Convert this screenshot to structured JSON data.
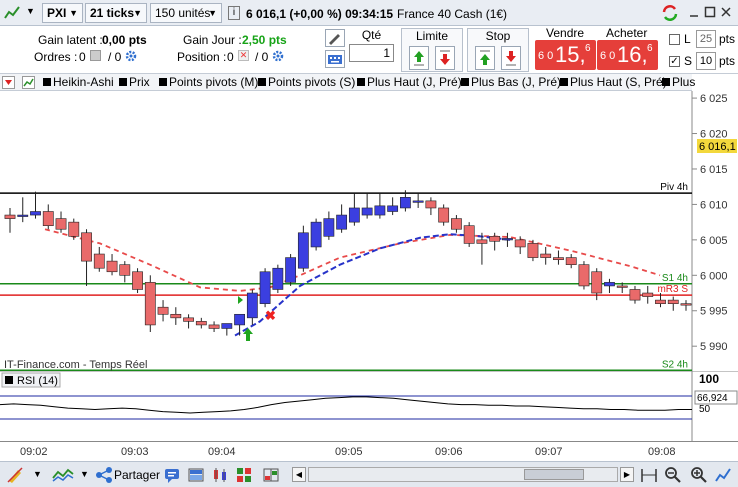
{
  "topbar": {
    "symbol": "PXI",
    "period": "21 ticks",
    "quantity": "150 unités",
    "price_line": "6 016,1 (+0,00 %) 09:34:15",
    "instrument": "France 40 Cash (1€)"
  },
  "orders": {
    "gain_latent_label": "Gain latent :",
    "gain_latent_value": "0,00 pts",
    "ordres_label": "Ordres :",
    "ordres_a": "0",
    "ordres_b": "/ 0",
    "gain_jour_label": "Gain Jour :",
    "gain_jour_value": "2,50 pts",
    "position_label": "Position :",
    "position_a": "0",
    "position_b": "/ 0",
    "qty_label": "Qté",
    "qty_value": "1",
    "limit_label": "Limite",
    "stop_label": "Stop",
    "sell_label": "Vendre",
    "sell_prefix": "6 0",
    "sell_big": "15,",
    "sell_sup": "6",
    "buy_label": "Acheter",
    "buy_prefix": "6 0",
    "buy_big": "16,",
    "buy_sup": "6",
    "l_label": "L",
    "l_value": "25",
    "l_unit": "pts",
    "s_label": "S",
    "s_value": "10",
    "s_unit": "pts"
  },
  "indicators": [
    {
      "label": "Heikin-Ashi",
      "color": "#000000"
    },
    {
      "label": "Prix",
      "color": "#000000"
    },
    {
      "label": "Points pivots (M)",
      "color": "#000000"
    },
    {
      "label": "Points pivots (S)",
      "color": "#000000"
    },
    {
      "label": "Plus Haut (J, Pré)",
      "color": "#000000"
    },
    {
      "label": "Plus Bas (J, Pré)",
      "color": "#000000"
    },
    {
      "label": "Plus Haut (S, Pré)",
      "color": "#000000"
    },
    {
      "label": "Plus",
      "color": "#000000"
    }
  ],
  "chart_data": {
    "type": "candlestick",
    "ylim": [
      5986.5,
      6026
    ],
    "yticks": [
      "6 025",
      "6 020",
      "6 015",
      "6 010",
      "6 005",
      "6 000",
      "5 995",
      "5 990"
    ],
    "last_price_label": "6 016,1",
    "source_label": "IT-Finance.com - Temps Réel",
    "lines": [
      {
        "label": "Piv 4h",
        "value": 6011.6,
        "color": "#000000"
      },
      {
        "label": "S1 4h",
        "value": 5998.8,
        "color": "#1a8a1a"
      },
      {
        "label": "mR3 S",
        "value": 5997.2,
        "color": "#e02020"
      },
      {
        "label": "S2 4h",
        "value": 5986.6,
        "color": "#1a8a1a"
      }
    ],
    "candles": [
      [
        6008.5,
        6009.5,
        6006,
        6008
      ],
      [
        6008.5,
        6011,
        6007.5,
        6008.5
      ],
      [
        6008.5,
        6011.8,
        6008,
        6009
      ],
      [
        6009,
        6010,
        6006.5,
        6007
      ],
      [
        6008,
        6009,
        6006,
        6006.5
      ],
      [
        6007.5,
        6008,
        6005,
        6005.5
      ],
      [
        6006,
        6006.5,
        5998.5,
        6002
      ],
      [
        6003,
        6004,
        6000.5,
        6001
      ],
      [
        6002,
        6003,
        6000,
        6000.5
      ],
      [
        6001.5,
        6002,
        5999,
        6000
      ],
      [
        6000.5,
        6001,
        5997.5,
        5998
      ],
      [
        5999,
        6000,
        5992,
        5993
      ],
      [
        5995.5,
        5996.5,
        5993.5,
        5994.5
      ],
      [
        5994.5,
        5995.5,
        5993,
        5994
      ],
      [
        5994,
        5994.5,
        5992.5,
        5993.5
      ],
      [
        5993.5,
        5994,
        5992.5,
        5993
      ],
      [
        5993,
        5993.5,
        5992,
        5992.5
      ],
      [
        5992.5,
        5993,
        5991.5,
        5993.2
      ],
      [
        5993,
        5994,
        5991.5,
        5994.5
      ],
      [
        5994,
        5998,
        5993,
        5997.5
      ],
      [
        5996,
        6001,
        5995.5,
        6000.5
      ],
      [
        5998,
        6001.5,
        5997.5,
        6001
      ],
      [
        5999,
        6003,
        5998.5,
        6002.5
      ],
      [
        6001,
        6007,
        6000.5,
        6006
      ],
      [
        6004,
        6008,
        6003.5,
        6007.5
      ],
      [
        6005.5,
        6009,
        6005,
        6008
      ],
      [
        6006.5,
        6010,
        6006,
        6008.5
      ],
      [
        6007.5,
        6011.5,
        6007,
        6009.5
      ],
      [
        6008.5,
        6011.5,
        6008,
        6009.5
      ],
      [
        6008.5,
        6011.5,
        6008,
        6009.8
      ],
      [
        6009,
        6011,
        6008.5,
        6009.8
      ],
      [
        6009.5,
        6012,
        6009,
        6011
      ],
      [
        6010.5,
        6011.5,
        6009.5,
        6010.5
      ],
      [
        6010.5,
        6011,
        6008.5,
        6009.5
      ],
      [
        6009.5,
        6010,
        6007,
        6007.5
      ],
      [
        6008,
        6008.5,
        6006,
        6006.5
      ],
      [
        6007,
        6007.5,
        6004,
        6004.5
      ],
      [
        6005,
        6006,
        6001.5,
        6004.5
      ],
      [
        6005.5,
        6006,
        6003.5,
        6004.8
      ],
      [
        6005,
        6006,
        6004,
        6005.2
      ],
      [
        6005,
        6005.5,
        6003,
        6004
      ],
      [
        6004.5,
        6005,
        6002,
        6002.5
      ],
      [
        6003,
        6004,
        6001.5,
        6002.5
      ],
      [
        6002.5,
        6003.5,
        6001.5,
        6002.2
      ],
      [
        6002.5,
        6003,
        6001,
        6001.5
      ],
      [
        6001.5,
        6002,
        5998,
        5998.5
      ],
      [
        6000.5,
        6001,
        5996.5,
        5997.5
      ],
      [
        5998.5,
        5999.5,
        5997.5,
        5999
      ],
      [
        5998.5,
        5999,
        5997.5,
        5998.3
      ],
      [
        5998,
        5998.5,
        5996,
        5996.5
      ],
      [
        5997.5,
        5998.5,
        5996,
        5997
      ],
      [
        5996.5,
        5997.5,
        5995.5,
        5996
      ],
      [
        5996.5,
        5997,
        5995,
        5996
      ],
      [
        5996,
        5996.5,
        5995,
        5995.8
      ]
    ],
    "ma_blue": [
      {
        "x": 235,
        "y": 5991.5
      },
      {
        "x": 260,
        "y": 5993.5
      },
      {
        "x": 300,
        "y": 5998.5
      },
      {
        "x": 340,
        "y": 6001.5
      },
      {
        "x": 380,
        "y": 6003.8
      },
      {
        "x": 420,
        "y": 6005.3
      },
      {
        "x": 450,
        "y": 6005.8
      },
      {
        "x": 480,
        "y": 6005.5
      },
      {
        "x": 510,
        "y": 6005
      }
    ],
    "ma_red": [
      {
        "x": 45,
        "y": 6006.5
      },
      {
        "x": 100,
        "y": 6004.5
      },
      {
        "x": 150,
        "y": 6001.5
      },
      {
        "x": 200,
        "y": 5998.3
      },
      {
        "x": 240,
        "y": 5997.8
      },
      {
        "x": 270,
        "y": 5998.3
      },
      {
        "x": 300,
        "y": 6000
      },
      {
        "x": 340,
        "y": 6002.5
      },
      {
        "x": 400,
        "y": 6004.5
      },
      {
        "x": 450,
        "y": 6005.7
      },
      {
        "x": 510,
        "y": 6005.4
      },
      {
        "x": 570,
        "y": 6003.5
      },
      {
        "x": 630,
        "y": 6001.3
      },
      {
        "x": 660,
        "y": 6000
      }
    ]
  },
  "rsi": {
    "label": "RSI (14)",
    "ticks": [
      "100",
      "50"
    ],
    "value_label": "66,924",
    "ylim": [
      0,
      100
    ]
  },
  "xaxis": {
    "ticks": [
      "09:02",
      "09:03",
      "09:04",
      "09:05",
      "09:06",
      "09:07",
      "09:08"
    ]
  },
  "bottombar": {
    "share_label": "Partager"
  },
  "colors": {
    "bull": "#3b3fe0",
    "bear": "#e96a6a",
    "sell": "#e53f3a"
  }
}
